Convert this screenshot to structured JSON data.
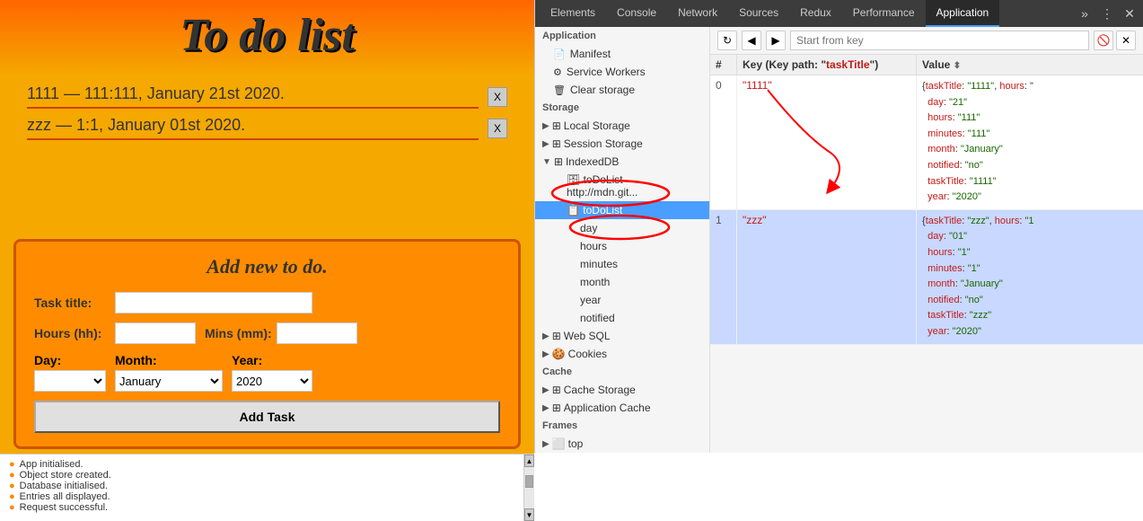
{
  "app": {
    "title": "To do list",
    "todos": [
      {
        "text": "1111 — 111:111, January 21st 2020.",
        "remove_label": "X"
      },
      {
        "text": "zzz — 1:1, January 01st 2020.",
        "remove_label": "X"
      }
    ],
    "form": {
      "title": "Add new to do.",
      "task_title_label": "Task title:",
      "hours_label": "Hours (hh):",
      "mins_label": "Mins (mm):",
      "day_label": "Day:",
      "month_label": "Month:",
      "year_label": "Year:",
      "month_value": "January",
      "year_value": "2020",
      "add_button": "Add Task"
    },
    "console_lines": [
      "App initialised.",
      "Object store created.",
      "Database initialised.",
      "Entries all displayed.",
      "Request successful."
    ]
  },
  "devtools": {
    "tabs": [
      "Elements",
      "Console",
      "Network",
      "Sources",
      "Redux",
      "Performance",
      "Application"
    ],
    "active_tab": "Application",
    "toolbar": {
      "search_placeholder": "Start from key"
    },
    "sidebar": {
      "application_header": "Application",
      "items": [
        {
          "label": "Manifest",
          "icon": "📄"
        },
        {
          "label": "Service Workers",
          "icon": "⚙"
        },
        {
          "label": "Clear storage",
          "icon": "🗑"
        }
      ],
      "storage_header": "Storage",
      "storage_items": [
        {
          "label": "Local Storage",
          "expandable": true
        },
        {
          "label": "Session Storage",
          "expandable": true
        },
        {
          "label": "IndexedDB",
          "expandable": true,
          "active": true
        },
        {
          "label": "toDoList - http://mdn.git",
          "sub": true
        },
        {
          "label": "toDoList",
          "sub": true,
          "active": true
        },
        {
          "label": "day",
          "subsub": true
        },
        {
          "label": "hours",
          "subsub": true
        },
        {
          "label": "minutes",
          "subsub": true
        },
        {
          "label": "month",
          "subsub": true
        },
        {
          "label": "year",
          "subsub": true
        },
        {
          "label": "notified",
          "subsub": true
        },
        {
          "label": "Web SQL",
          "expandable": true
        },
        {
          "label": "Cookies",
          "expandable": true
        }
      ],
      "cache_header": "Cache",
      "cache_items": [
        {
          "label": "Cache Storage",
          "expandable": true
        },
        {
          "label": "Application Cache",
          "expandable": true
        }
      ],
      "frames_header": "Frames",
      "frames_items": [
        {
          "label": "top"
        }
      ]
    },
    "table": {
      "headers": [
        "#",
        "Key (Key path: \"taskTitle\")",
        "Value"
      ],
      "rows": [
        {
          "index": "0",
          "key": "\"1111\"",
          "value_lines": [
            "{taskTitle: \"1111\", hours: \"",
            "day: \"21\"",
            "hours: \"111\"",
            "minutes: \"111\"",
            "month: \"January\"",
            "notified: \"no\"",
            "taskTitle: \"1111\"",
            "year: \"2020\""
          ]
        },
        {
          "index": "1",
          "key": "\"zzz\"",
          "value_lines": [
            "{taskTitle: \"zzz\", hours: \"1",
            "day: \"01\"",
            "hours: \"1\"",
            "minutes: \"1\"",
            "month: \"January\"",
            "notified: \"no\"",
            "taskTitle: \"zzz\"",
            "year: \"2020\""
          ]
        }
      ]
    }
  }
}
